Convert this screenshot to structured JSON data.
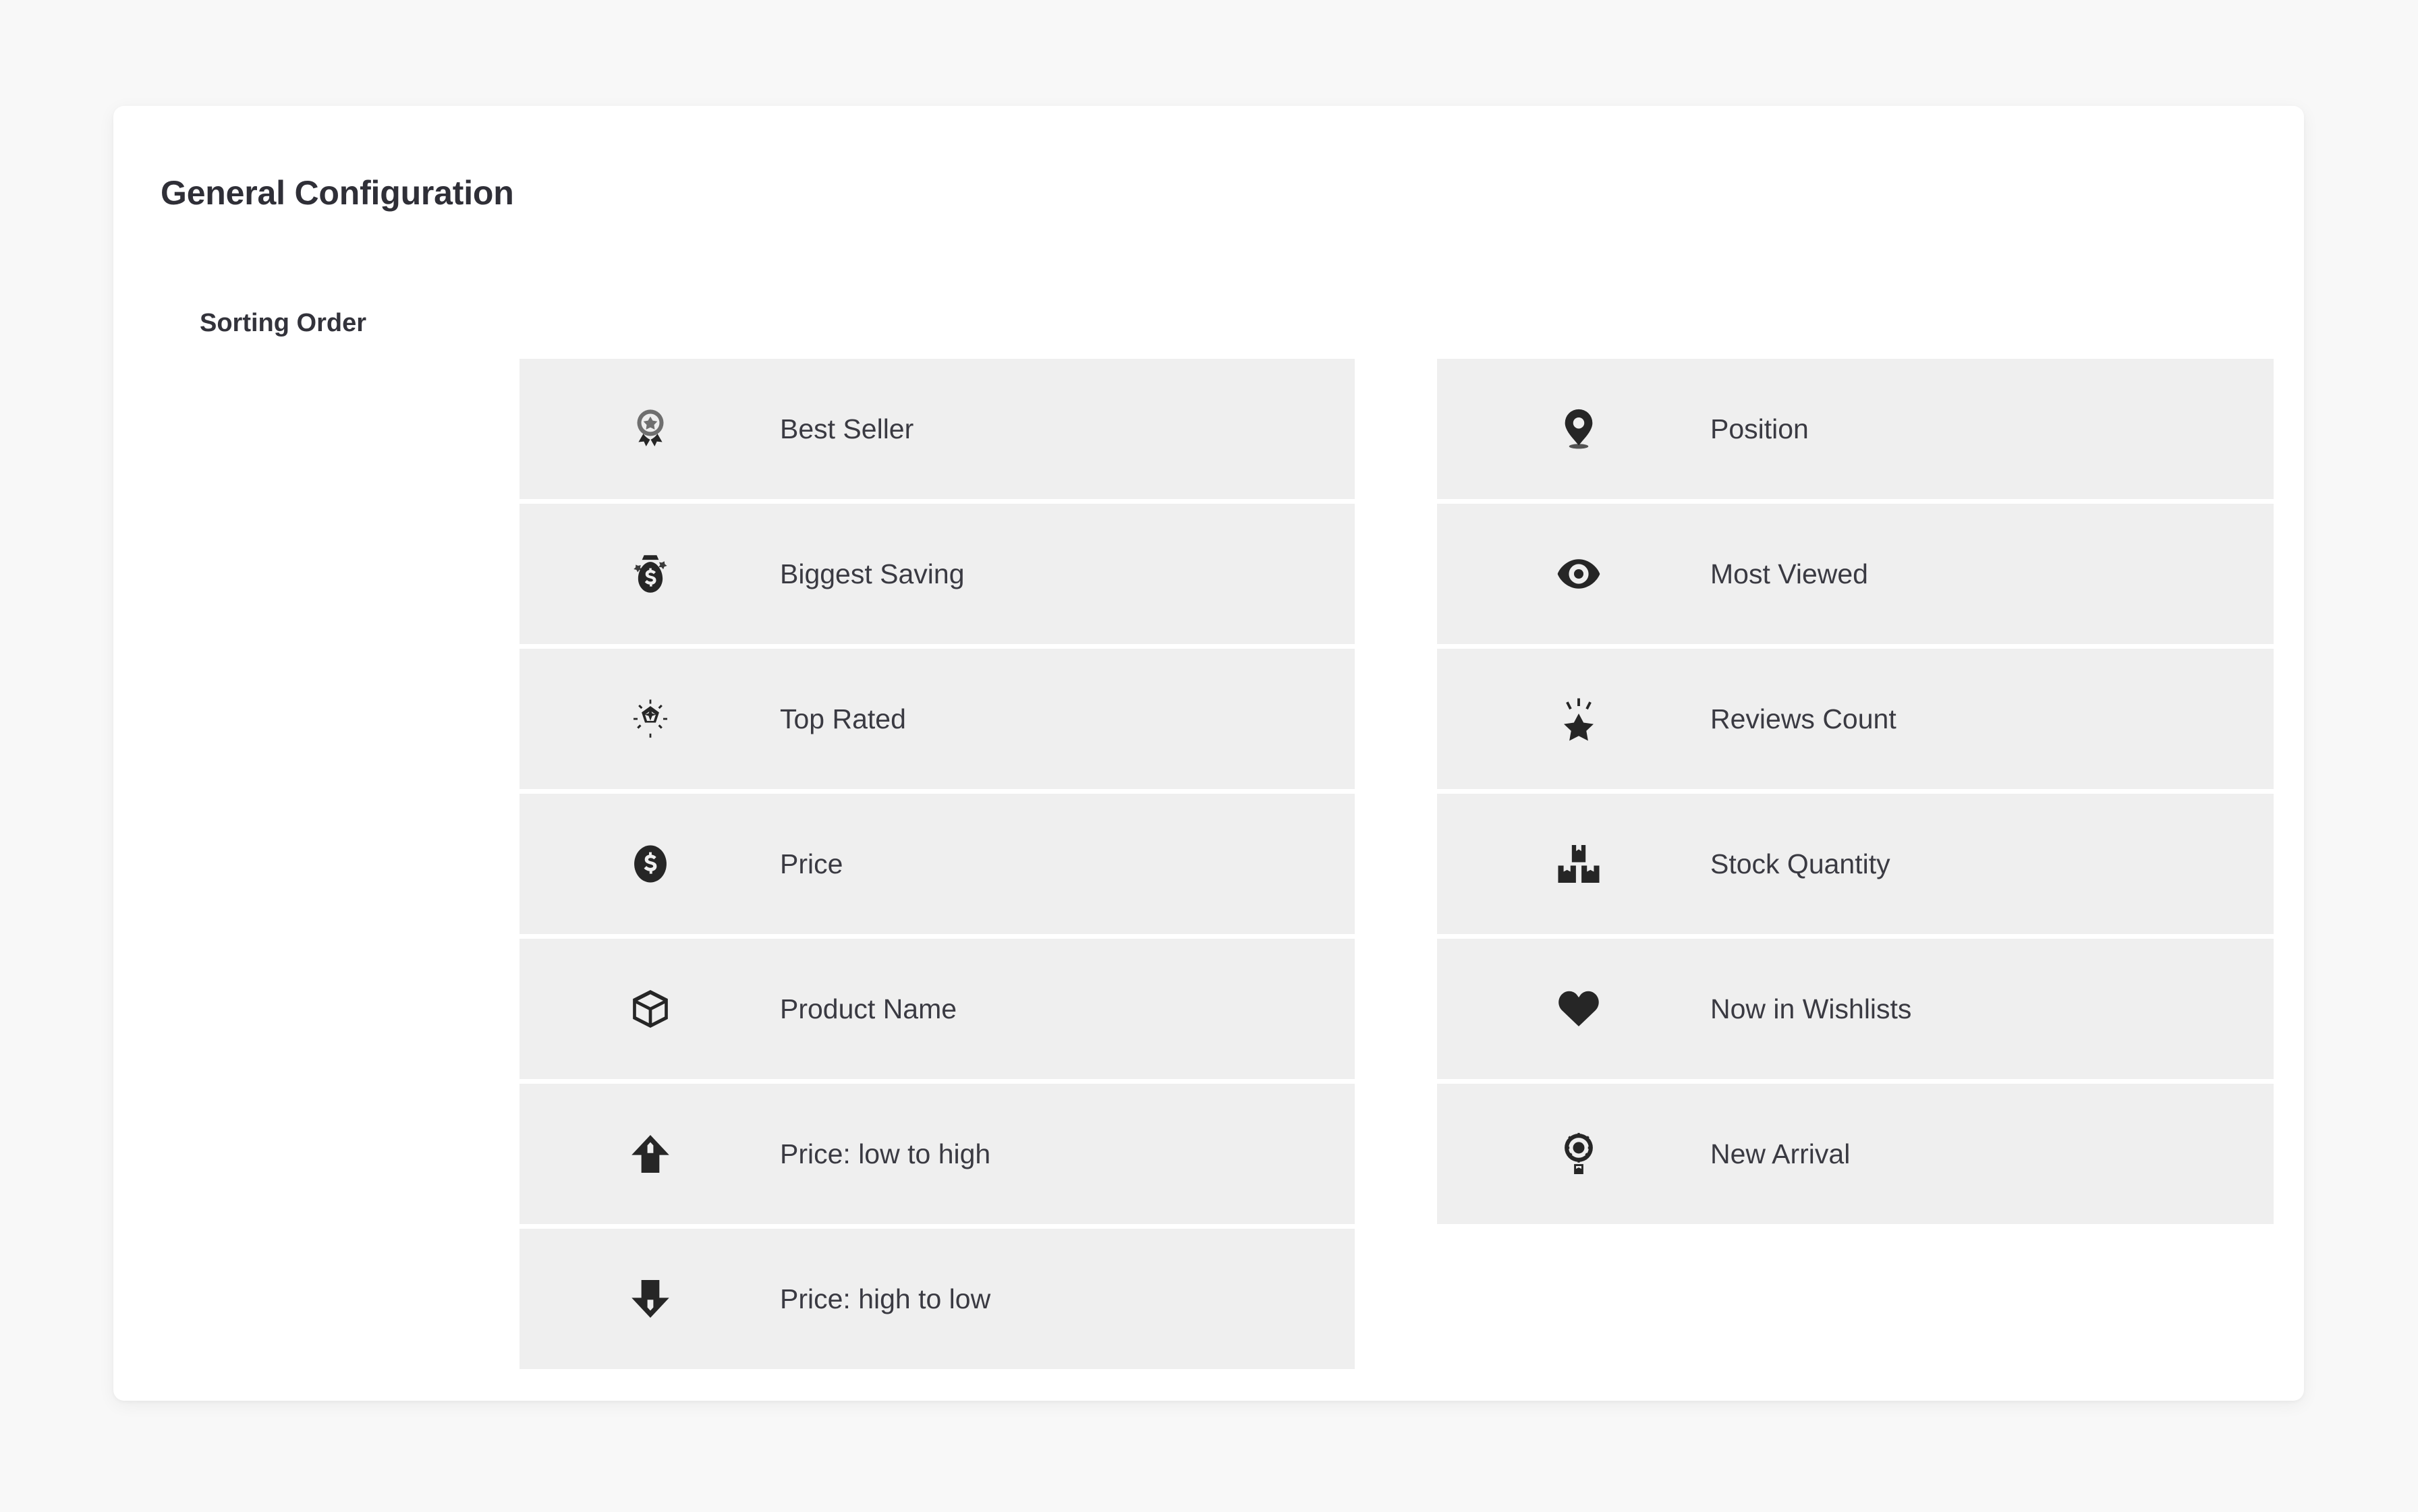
{
  "page": {
    "background_color": "#f8f8f8",
    "card_background_color": "#ffffff"
  },
  "card": {
    "title": "General Configuration",
    "section_label": "Sorting Order",
    "row_background_color": "#efefef",
    "label_color": "#3a3a42",
    "icon_color": "#262626"
  },
  "sorting_order": {
    "left_column": [
      {
        "label": "Best Seller",
        "icon": "award-ribbon-icon"
      },
      {
        "label": "Biggest Saving",
        "icon": "money-bag-icon"
      },
      {
        "label": "Top Rated",
        "icon": "sparkle-star-outline-icon"
      },
      {
        "label": "Price",
        "icon": "dollar-coin-icon"
      },
      {
        "label": "Product Name",
        "icon": "cube-box-icon"
      },
      {
        "label": "Price: low to high",
        "icon": "arrow-up-icon"
      },
      {
        "label": "Price: high to low",
        "icon": "arrow-down-icon"
      }
    ],
    "right_column": [
      {
        "label": "Position",
        "icon": "map-pin-icon"
      },
      {
        "label": "Most Viewed",
        "icon": "eye-icon"
      },
      {
        "label": "Reviews Count",
        "icon": "sparkle-star-filled-icon"
      },
      {
        "label": "Stock Quantity",
        "icon": "stacked-boxes-icon"
      },
      {
        "label": "Now in Wishlists",
        "icon": "heart-icon"
      },
      {
        "label": "New Arrival",
        "icon": "medal-rosette-icon"
      }
    ]
  }
}
